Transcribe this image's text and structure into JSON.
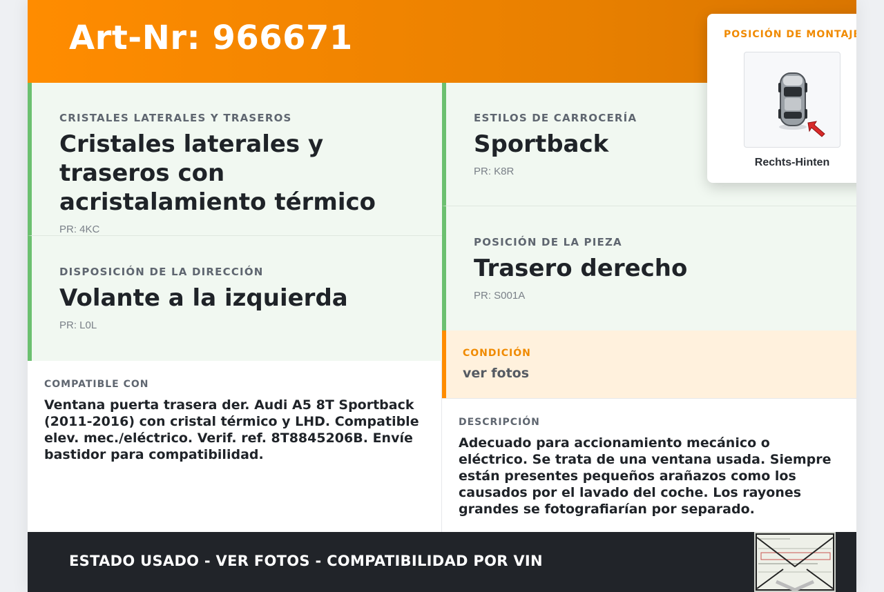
{
  "header": {
    "title": "Art-Nr: 966671"
  },
  "cells": {
    "glass": {
      "label": "Cristales laterales y traseros",
      "value": "Cristales laterales y traseros con acristalamiento térmico",
      "code": "PR: 4KC"
    },
    "steering": {
      "label": "Disposición de la dirección",
      "value": "Volante a la izquierda",
      "code": "PR: L0L"
    },
    "body": {
      "label": "Estilos de carrocería",
      "value": "Sportback",
      "code": "PR: K8R"
    },
    "position": {
      "label": "Posición de la pieza",
      "value": "Trasero derecho",
      "code": "PR: S001A"
    }
  },
  "condition": {
    "label": "Condición",
    "value": "ver fotos"
  },
  "compatible": {
    "label": "Compatible con",
    "text": "Ventana puerta trasera der. Audi A5 8T Sportback (2011-2016) con cristal térmico y LHD. Compatible elev. mec./eléctrico. Verif. ref. 8T8845206B. Envíe bastidor para compatibilidad."
  },
  "description": {
    "label": "Descripción",
    "text": "Adecuado para accionamiento mecánico o eléctrico. Se trata de una ventana usada. Siempre están presentes pequeños arañazos como los causados por el lavado del coche. Los rayones grandes se fotografiarían por separado."
  },
  "mount": {
    "title": "POSICIÓN DE MONTAJE",
    "position": "Rechts-Hinten"
  },
  "footer": {
    "text": "ESTADO USADO - VER FOTOS - COMPATIBILIDAD POR VIN"
  },
  "colors": {
    "accent": "#ff8c00",
    "green": "#6cc070",
    "dark": "#212429"
  },
  "icons": {
    "car": "car-top-view-icon",
    "arrow": "red-arrow-icon",
    "stamp": "document-stamp-icon"
  }
}
